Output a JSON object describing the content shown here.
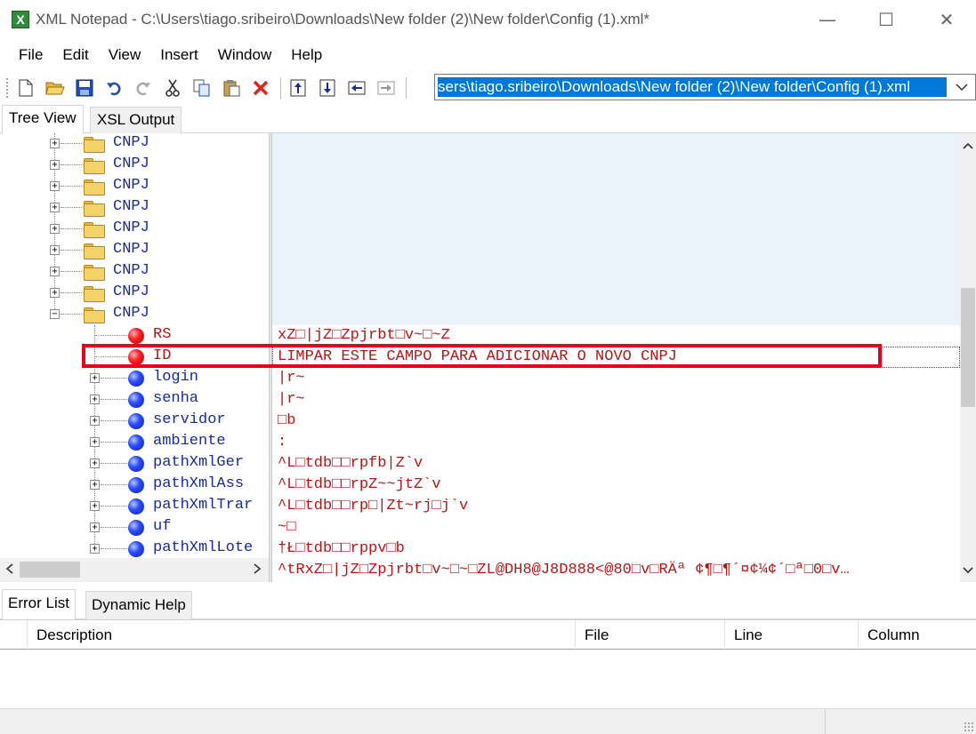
{
  "window": {
    "title": "XML Notepad - C:\\Users\\tiago.sribeiro\\Downloads\\New folder (2)\\New folder\\Config (1).xml*",
    "app_icon_letter": "X",
    "minimize": "—",
    "maximize": "☐",
    "close": "✕"
  },
  "menu": {
    "file": "File",
    "edit": "Edit",
    "view": "View",
    "insert": "Insert",
    "window": "Window",
    "help": "Help"
  },
  "toolbar": {
    "icons": [
      "new-icon",
      "open-icon",
      "save-icon",
      "undo-icon",
      "redo-icon",
      "cut-icon",
      "copy-icon",
      "paste-icon",
      "delete-icon",
      "nudge-up-icon",
      "nudge-down-icon",
      "nudge-left-icon",
      "nudge-right-icon"
    ],
    "address": "sers\\tiago.sribeiro\\Downloads\\New folder (2)\\New folder\\Config (1).xml"
  },
  "tabs": {
    "tree_view": "Tree View",
    "xsl_output": "XSL Output"
  },
  "tree": {
    "folders": [
      "CNPJ",
      "CNPJ",
      "CNPJ",
      "CNPJ",
      "CNPJ",
      "CNPJ",
      "CNPJ",
      "CNPJ",
      "CNPJ"
    ],
    "attributes": [
      "RS",
      "ID"
    ],
    "elements": [
      "login",
      "senha",
      "servidor",
      "ambiente",
      "pathXmlGer",
      "pathXmlAss",
      "pathXmlTrar",
      "uf",
      "pathXmlLote"
    ]
  },
  "values": {
    "rs": "xZ□|jZ□Zpjrbt□v~□~Z",
    "id": "LIMPAR ESTE CAMPO PARA ADICIONAR O NOVO CNPJ",
    "login": "|r~",
    "senha": "|r~",
    "servidor": "□b",
    "ambiente": ":",
    "pathXmlGer": "^L□tdb□□rpfb|Z`v",
    "pathXmlAss": "^L□tdb□□rpZ~~jtZ`v",
    "pathXmlTrar": "^L□tdb□□rp□|Zt~rj□j`v",
    "uf": "~□",
    "pathXmlLote": "†Ł□tdb□□rppv□b",
    "overflow": "^tRxZ□|jZ□Zpjrbt□v~□~□ZL@DH8@J8D888<@80□v□RÄª ¢¶□¶´¤¢¼¢´□ª□0□v…"
  },
  "bottom": {
    "tabs": {
      "error_list": "Error List",
      "dynamic_help": "Dynamic Help"
    },
    "columns": {
      "description": "Description",
      "file": "File",
      "line": "Line",
      "column": "Column"
    }
  },
  "colors": {
    "highlight_box": "#e8001c",
    "element_text": "#1a2a9c",
    "value_text": "#b01818",
    "selection": "#0078d7"
  }
}
